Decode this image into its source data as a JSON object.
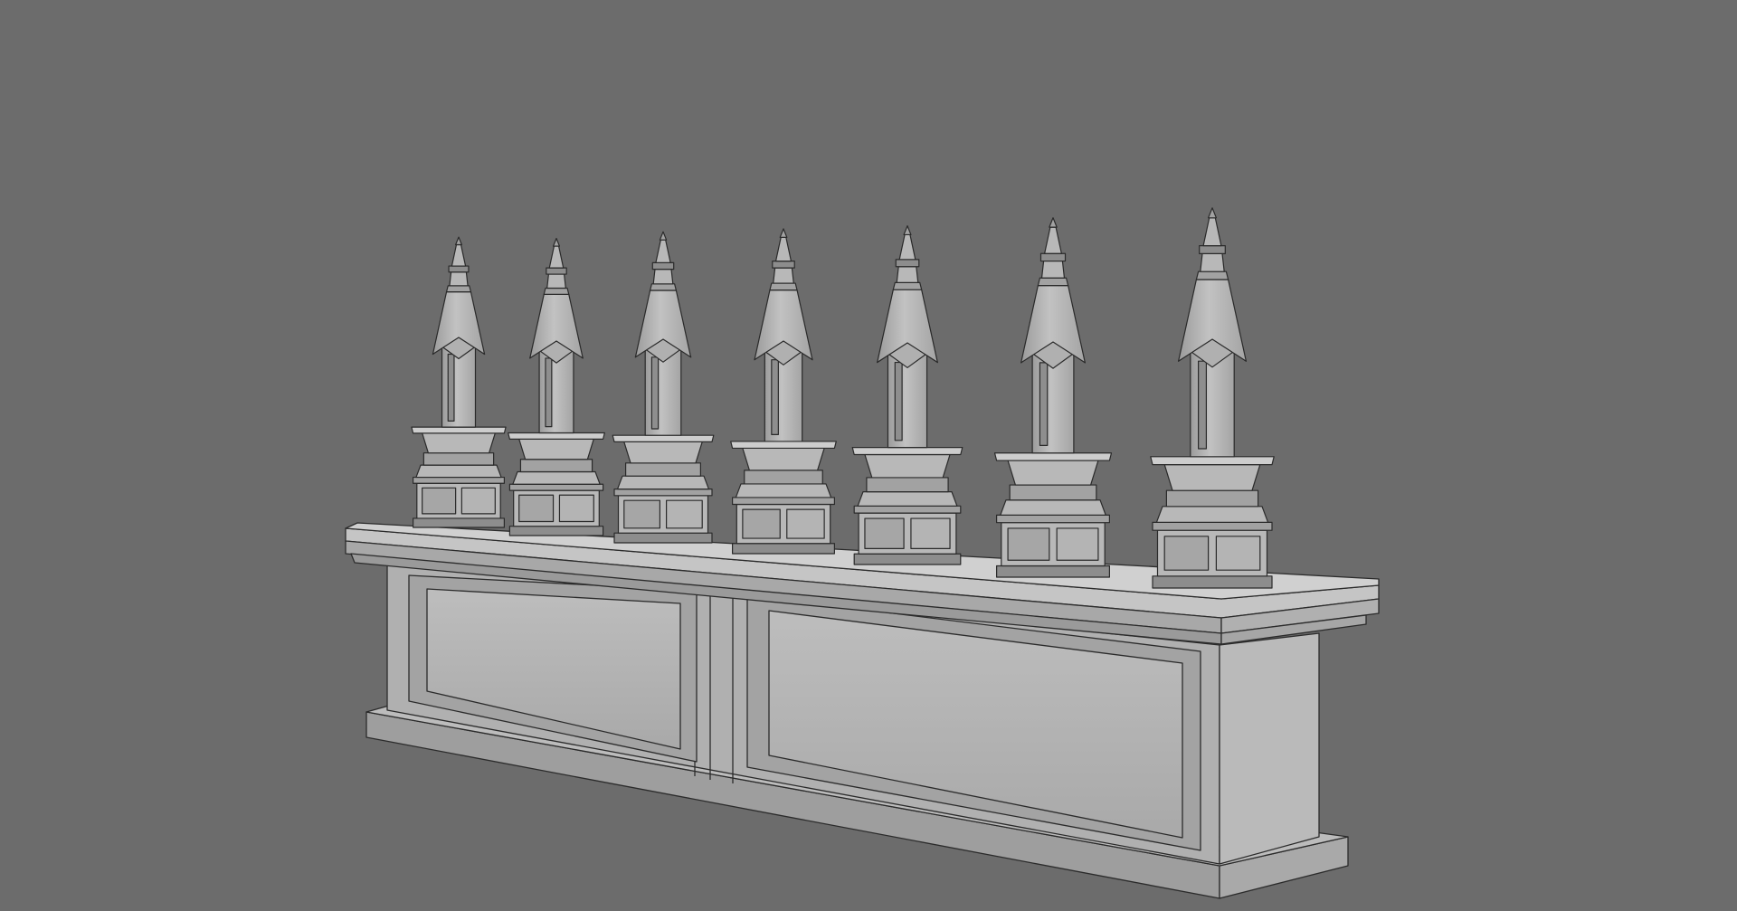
{
  "viewport": {
    "background": "#6c6c6c",
    "shading": "wireframe-on-shaded"
  },
  "model": {
    "name": "",
    "spire_count": 7,
    "panel_count": 2,
    "colors": {
      "surface_light": "#b8b8b8",
      "surface_mid": "#a2a2a2",
      "surface_dark": "#8d8d8d",
      "edge": "#2a2a2a"
    }
  }
}
